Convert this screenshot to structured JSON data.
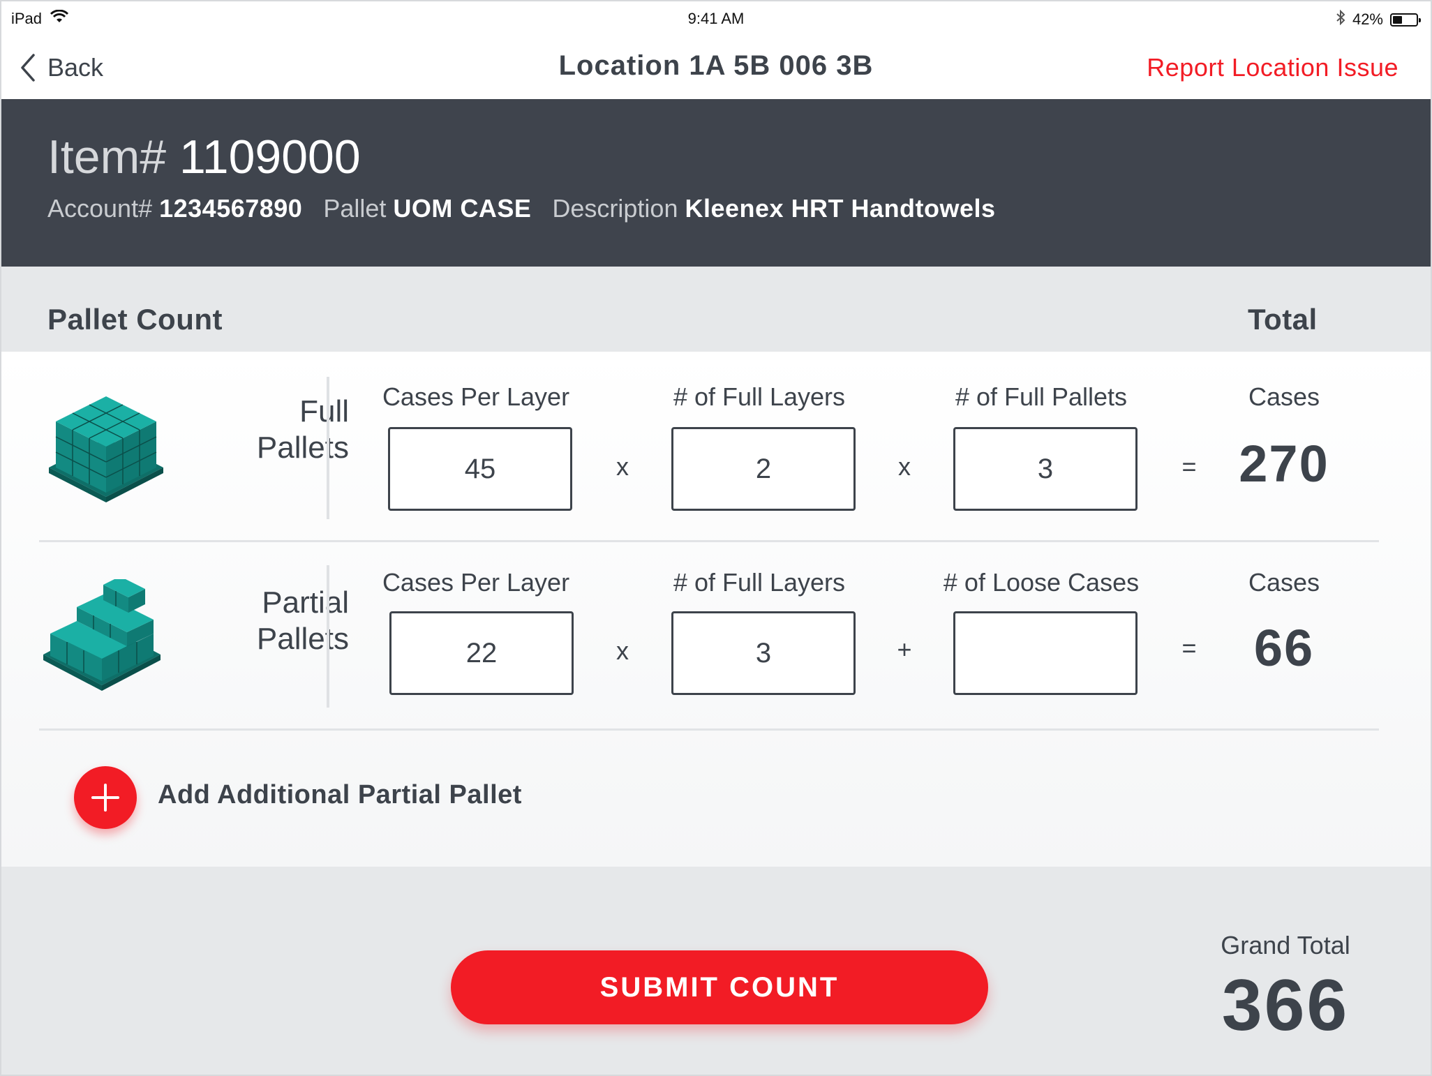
{
  "status_bar": {
    "device": "iPad",
    "time": "9:41 AM",
    "battery_text": "42%",
    "battery_level": 0.42,
    "wifi_icon": "wifi-icon",
    "bluetooth_icon": "bluetooth-icon"
  },
  "nav": {
    "back_label": "Back",
    "title": "Location 1A 5B 006 3B",
    "report_label": "Report Location Issue"
  },
  "item": {
    "title_label": "Item#",
    "title_value": "1109000",
    "account_label": "Account#",
    "account_value": "1234567890",
    "pallet_label": "Pallet",
    "pallet_value": "UOM CASE",
    "description_label": "Description",
    "description_value": "Kleenex HRT Handtowels"
  },
  "count_header": {
    "left": "Pallet Count",
    "right": "Total"
  },
  "rows": [
    {
      "label_line1": "Full",
      "label_line2": "Pallets",
      "col1_header": "Cases Per Layer",
      "col1_value": "45",
      "op1": "x",
      "col2_header": "# of Full Layers",
      "col2_value": "2",
      "op2": "x",
      "col3_header": "# of Full Pallets",
      "col3_value": "3",
      "equals": "=",
      "total_header": "Cases",
      "total_value": "270"
    },
    {
      "label_line1": "Partial",
      "label_line2": "Pallets",
      "col1_header": "Cases Per Layer",
      "col1_value": "22",
      "op1": "x",
      "col2_header": "# of Full Layers",
      "col2_value": "3",
      "op2": "+",
      "col3_header": "# of Loose Cases",
      "col3_value": "",
      "equals": "=",
      "total_header": "Cases",
      "total_value": "66"
    }
  ],
  "add_partial_label": "Add Additional Partial Pallet",
  "footer": {
    "submit_label": "SUBMIT COUNT",
    "grand_total_label": "Grand Total",
    "grand_total_value": "366"
  },
  "colors": {
    "accent": "#f21c25",
    "header_bg": "#3f444d",
    "text": "#3d434b",
    "pallet_teal": "#17938a"
  }
}
